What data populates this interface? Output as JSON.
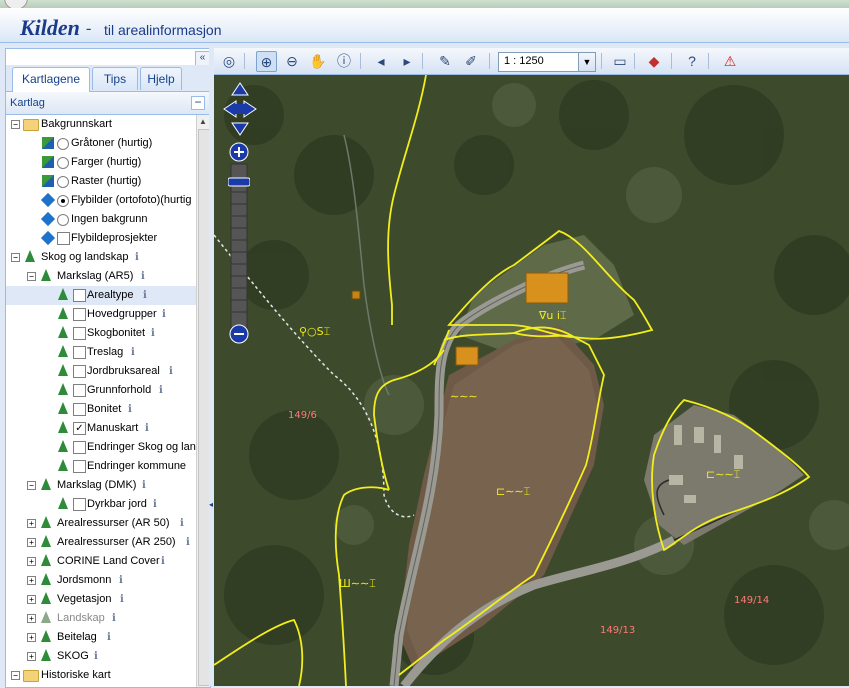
{
  "app": {
    "logo": "Kilden",
    "dash": "-",
    "subtitle": "til arealinformasjon"
  },
  "left_panel": {
    "collapse_glyph": "«",
    "tabs": [
      {
        "label": "Kartlagene"
      },
      {
        "label": "Tips"
      },
      {
        "label": "Hjelp"
      }
    ],
    "header": "Kartlag",
    "tree": [
      {
        "label": "Bakgrunnskart"
      },
      {
        "label": "Gråtoner (hurtig)"
      },
      {
        "label": "Farger (hurtig)"
      },
      {
        "label": "Raster (hurtig)"
      },
      {
        "label": "Flybilder (ortofoto)(hurtig"
      },
      {
        "label": "Ingen bakgrunn"
      },
      {
        "label": "Flybildeprosjekter"
      },
      {
        "label": "Skog og landskap"
      },
      {
        "label": "Markslag (AR5)"
      },
      {
        "label": "Arealtype"
      },
      {
        "label": "Hovedgrupper"
      },
      {
        "label": "Skogbonitet"
      },
      {
        "label": "Treslag"
      },
      {
        "label": "Jordbruksareal"
      },
      {
        "label": "Grunnforhold"
      },
      {
        "label": "Bonitet"
      },
      {
        "label": "Manuskart"
      },
      {
        "label": "Endringer Skog og lan"
      },
      {
        "label": "Endringer kommune"
      },
      {
        "label": "Markslag (DMK)"
      },
      {
        "label": "Dyrkbar jord"
      },
      {
        "label": "Arealressurser (AR 50)"
      },
      {
        "label": "Arealressurser (AR 250)"
      },
      {
        "label": "CORINE Land Cover"
      },
      {
        "label": "Jordsmonn"
      },
      {
        "label": "Vegetasjon"
      },
      {
        "label": "Landskap"
      },
      {
        "label": "Beitelag"
      },
      {
        "label": "SKOG"
      },
      {
        "label": "Historiske kart"
      }
    ],
    "info_glyph": "i",
    "check_glyph": "✓"
  },
  "toolbar": {
    "scale": "1 : 1250"
  },
  "map": {
    "parcels": [
      "149/6",
      "149/13",
      "149/14"
    ],
    "symbols": [
      "⚲○S⌶",
      "∇u i⌶",
      "∼∼∼",
      "⊏∼∼⌶",
      "⊏∼∼⌶",
      "Ш∼∼⌶"
    ]
  }
}
